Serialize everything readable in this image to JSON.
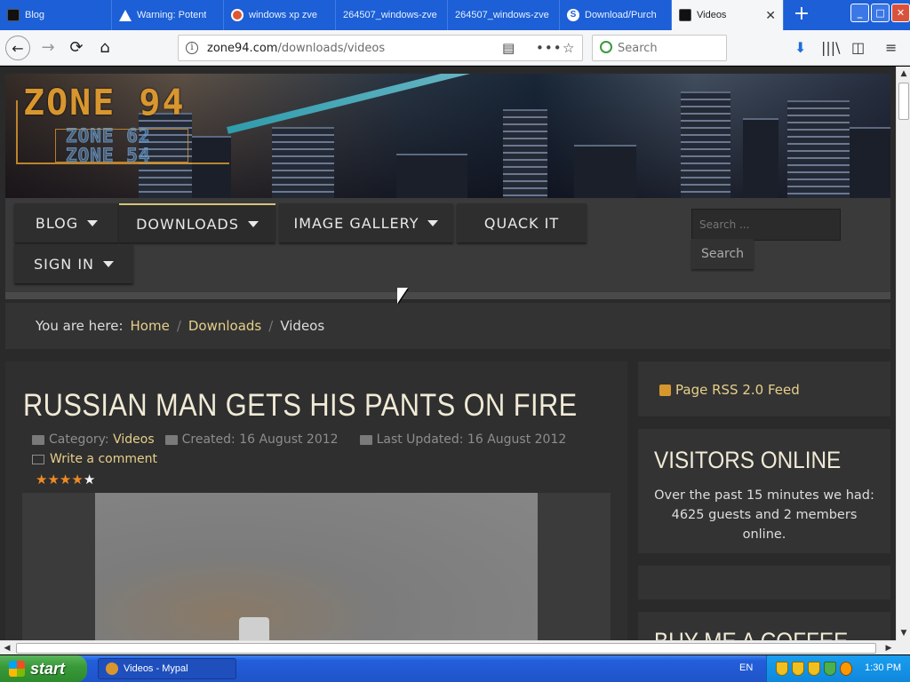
{
  "browser": {
    "tabs": [
      {
        "label": "Blog",
        "icon": "zone94-favicon-icon"
      },
      {
        "label": "Warning: Potent",
        "icon": "warning-icon"
      },
      {
        "label": "windows xp zve",
        "icon": "duckduckgo-icon"
      },
      {
        "label": "264507_windows-zve",
        "icon": "none"
      },
      {
        "label": "264507_windows-zve",
        "icon": "none"
      },
      {
        "label": "Download/Purch",
        "icon": "s-logo-icon"
      },
      {
        "label": "Videos",
        "icon": "zone94-favicon-icon",
        "active": true
      }
    ],
    "new_tab": "+",
    "window_buttons": {
      "minimize": "_",
      "maximize": "□",
      "close": "✕"
    },
    "url": {
      "host": "zone94.com",
      "path": "/downloads/videos"
    },
    "search_placeholder": "Search",
    "colors": {
      "tabstrip": "#1c5fd6",
      "toolbar": "#f5f6f7"
    }
  },
  "site": {
    "logo": {
      "main": "ZONE 94",
      "line2": "ZONE 62",
      "line3": "ZONE 54"
    },
    "menu": [
      {
        "label": "BLOG",
        "dropdown": true
      },
      {
        "label": "DOWNLOADS",
        "dropdown": true,
        "active": true
      },
      {
        "label": "IMAGE GALLERY",
        "dropdown": true
      },
      {
        "label": "QUACK IT",
        "dropdown": false
      },
      {
        "label": "SIGN IN",
        "dropdown": true
      }
    ],
    "search": {
      "placeholder": "Search ...",
      "button": "Search"
    },
    "breadcrumb": {
      "prefix": "You are here:",
      "items": [
        "Home",
        "Downloads",
        "Videos"
      ]
    },
    "article": {
      "title": "RUSSIAN MAN GETS HIS PANTS ON FIRE",
      "category_label": "Category:",
      "category": "Videos",
      "created": "Created: 16 August 2012",
      "updated": "Last Updated: 16 August 2012",
      "comment_link": "Write a comment",
      "rating": 4.5
    },
    "sidebar": {
      "rss": "Page RSS 2.0 Feed",
      "visitors_title": "VISITORS ONLINE",
      "visitors_text": "Over the past 15 minutes we had: 4625 guests and 2 members online.",
      "coffee_title": "BUY ME A COFFEE"
    },
    "colors": {
      "accent": "#e6cf8a",
      "logo": "#d8962e",
      "star": "#f08a24",
      "panel": "#333333"
    }
  },
  "taskbar": {
    "start": "start",
    "window_item": "Videos - Mypal",
    "language": "EN",
    "clock": "1:30 PM"
  }
}
